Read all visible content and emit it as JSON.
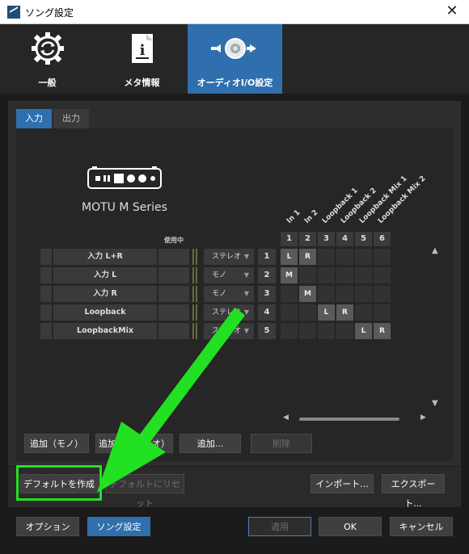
{
  "window": {
    "title": "ソング設定",
    "close_label": "✕"
  },
  "categories": [
    {
      "label": "一般",
      "icon": "gear-refresh-icon"
    },
    {
      "label": "メタ情報",
      "icon": "document-info-icon"
    },
    {
      "label": "オーディオI/O設定",
      "icon": "audio-io-icon",
      "active": true
    }
  ],
  "tabs": [
    {
      "label": "入力",
      "active": true
    },
    {
      "label": "出力"
    }
  ],
  "device": {
    "name": "MOTU M Series",
    "icon": "audio-interface-icon"
  },
  "matrix": {
    "in_use_label": "使用中",
    "columns": [
      {
        "num": "1",
        "label": "In 1"
      },
      {
        "num": "2",
        "label": "In 2"
      },
      {
        "num": "3",
        "label": "Loopback 1"
      },
      {
        "num": "4",
        "label": "Loopback 2"
      },
      {
        "num": "5",
        "label": "Loopback Mix 1"
      },
      {
        "num": "6",
        "label": "Loopback Mix 2"
      }
    ],
    "rows": [
      {
        "name": "入力 L+R",
        "mode": "ステレオ",
        "num": "1",
        "cells": [
          "L",
          "R",
          "",
          "",
          "",
          ""
        ]
      },
      {
        "name": "入力 L",
        "mode": "モノ",
        "num": "2",
        "cells": [
          "M",
          "",
          "",
          "",
          "",
          ""
        ]
      },
      {
        "name": "入力 R",
        "mode": "モノ",
        "num": "3",
        "cells": [
          "",
          "M",
          "",
          "",
          "",
          ""
        ]
      },
      {
        "name": "Loopback",
        "mode": "ステレオ",
        "num": "4",
        "cells": [
          "",
          "",
          "L",
          "R",
          "",
          ""
        ]
      },
      {
        "name": "LoopbackMix",
        "mode": "ステレオ",
        "num": "5",
        "cells": [
          "",
          "",
          "",
          "",
          "L",
          "R"
        ]
      }
    ]
  },
  "buttons": {
    "add_mono": "追加（モノ）",
    "add_stereo": "追加（ステレオ）",
    "add": "追加...",
    "delete": "削除",
    "make_default": "デフォルトを作成",
    "reset_default": "デフォルトにリセット",
    "import": "インポート...",
    "export": "エクスポート...",
    "options": "オプション",
    "song_settings": "ソング設定",
    "apply": "適用",
    "ok": "OK",
    "cancel": "キャンセル"
  },
  "colors": {
    "accent": "#2f6fad",
    "highlight": "#22e022",
    "background": "#1b1b1b"
  }
}
